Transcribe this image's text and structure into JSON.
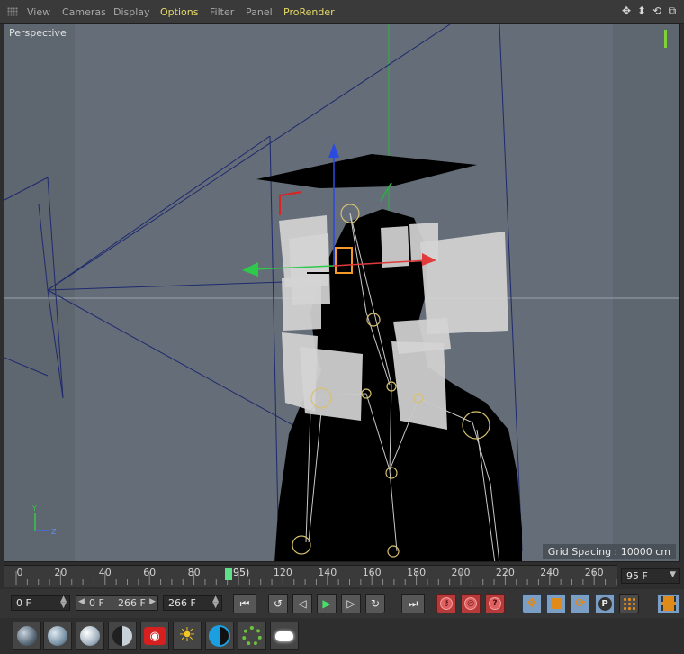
{
  "menu": {
    "items": [
      "View",
      "Cameras",
      "Display",
      "Options",
      "Filter",
      "Panel",
      "ProRender"
    ],
    "highlighted": [
      "Options",
      "ProRender"
    ],
    "nav_icons": [
      "move-view-icon",
      "dolly-view-icon",
      "rotate-view-icon",
      "toggle-view-icon"
    ]
  },
  "viewport": {
    "label": "Perspective",
    "grid_spacing": "Grid Spacing : 10000 cm",
    "axis_y": "Y",
    "axis_z": "Z"
  },
  "timeline": {
    "ticks": [
      "0",
      "20",
      "40",
      "60",
      "80",
      "120",
      "140",
      "160",
      "180",
      "200",
      "220",
      "240",
      "260"
    ],
    "playhead_label": "95)",
    "current_frame": "95 F"
  },
  "transport": {
    "start_field": "0 F",
    "range_start": "0 F",
    "range_end": "266 F",
    "end_field": "266 F"
  },
  "colors": {
    "viewport_bg": "#646d78",
    "accent_yellow": "#e6d86a",
    "playhead_green": "#5fe08a",
    "record_red": "#b73a3a"
  }
}
